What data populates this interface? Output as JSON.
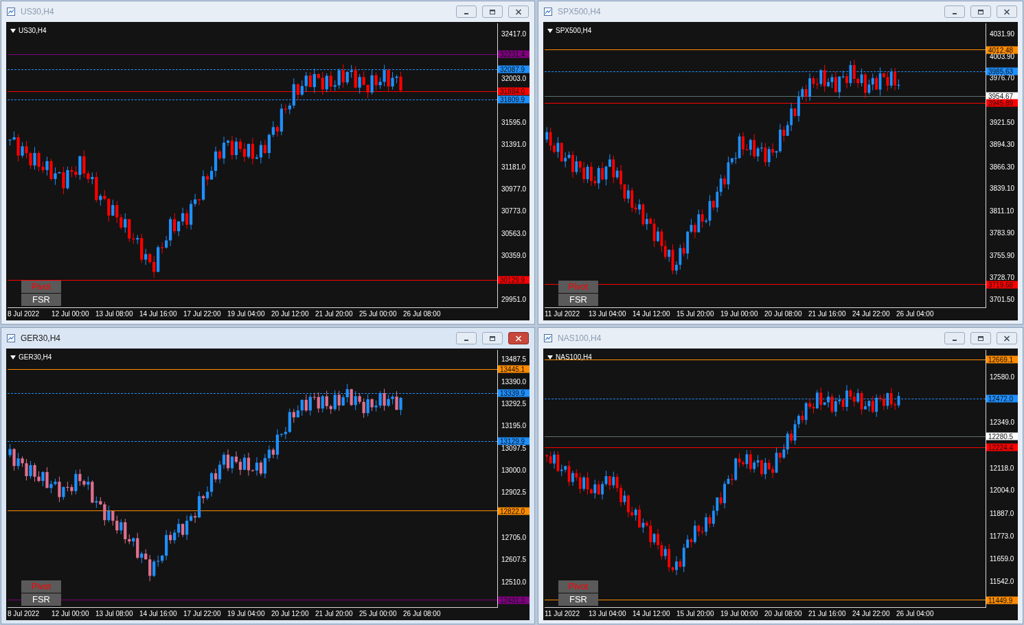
{
  "windows": [
    {
      "title": "US30,H4",
      "active": false,
      "chart_label": "US30,H4",
      "y_ticks": [
        "32417.0",
        "32003.0",
        "31595.0",
        "31391.0",
        "31181.0",
        "30977.0",
        "30773.0",
        "30563.0",
        "30359.0",
        "29951.0"
      ],
      "price_tags": [
        {
          "label": "32231.4",
          "color": "#800080",
          "dashed": false
        },
        {
          "label": "32087.9",
          "color": "#1e90ff",
          "dashed": true
        },
        {
          "label": "31884.0",
          "color": "#ff0000",
          "dashed": false
        },
        {
          "label": "31809.9",
          "color": "#1e90ff",
          "dashed": true
        },
        {
          "label": "30129.9",
          "color": "#ff0000",
          "dashed": false
        }
      ],
      "x_labels": [
        "8 Jul 2022",
        "12 Jul 00:00",
        "13 Jul 08:00",
        "14 Jul 16:00",
        "17 Jul 22:00",
        "19 Jul 04:00",
        "20 Jul 12:00",
        "21 Jul 20:00",
        "25 Jul 00:00",
        "26 Jul 08:00"
      ],
      "buttons": [
        "Pivot",
        "FSR"
      ]
    },
    {
      "title": "SPX500,H4",
      "active": false,
      "chart_label": "SPX500,H4",
      "y_ticks": [
        "4031.90",
        "4003.90",
        "3976.70",
        "3921.50",
        "3894.30",
        "3866.30",
        "3839.10",
        "3811.10",
        "3783.90",
        "3755.90",
        "3728.70",
        "3701.50"
      ],
      "price_tags": [
        {
          "label": "4012.48",
          "color": "#ff8c00",
          "dashed": false
        },
        {
          "label": "3985.63",
          "color": "#1e90ff",
          "dashed": true
        },
        {
          "label": "3954.67",
          "color": "#ffffff",
          "dashed": false
        },
        {
          "label": "3945.89",
          "color": "#ff0000",
          "dashed": false
        },
        {
          "label": "3719.68",
          "color": "#ff0000",
          "dashed": false
        }
      ],
      "x_labels": [
        "11 Jul 2022",
        "13 Jul 04:00",
        "14 Jul 12:00",
        "15 Jul 20:00",
        "19 Jul 00:00",
        "20 Jul 08:00",
        "21 Jul 16:00",
        "24 Jul 22:00",
        "26 Jul 04:00"
      ],
      "buttons": [
        "Pivot",
        "FSR"
      ]
    },
    {
      "title": "GER30,H4",
      "active": true,
      "chart_label": "GER30,H4",
      "y_ticks": [
        "13487.5",
        "13390.0",
        "13292.5",
        "13195.0",
        "13097.5",
        "13000.0",
        "12902.5",
        "12705.0",
        "12607.5",
        "12510.0"
      ],
      "price_tags": [
        {
          "label": "13445.1",
          "color": "#ff8c00",
          "dashed": false
        },
        {
          "label": "13339.9",
          "color": "#1e90ff",
          "dashed": true
        },
        {
          "label": "13129.9",
          "color": "#1e90ff",
          "dashed": true
        },
        {
          "label": "12822.0",
          "color": "#ff8c00",
          "dashed": false
        },
        {
          "label": "12431.3",
          "color": "#800080",
          "dashed": false
        }
      ],
      "x_labels": [
        "8 Jul 2022",
        "12 Jul 00:00",
        "13 Jul 08:00",
        "14 Jul 16:00",
        "17 Jul 22:00",
        "19 Jul 04:00",
        "20 Jul 12:00",
        "21 Jul 20:00",
        "25 Jul 00:00",
        "26 Jul 08:00"
      ],
      "buttons": [
        "Pivot",
        "FSR"
      ]
    },
    {
      "title": "NAS100,H4",
      "active": false,
      "chart_label": "NAS100,H4",
      "y_ticks": [
        "12580.0",
        "12349.0",
        "12118.0",
        "12004.0",
        "11887.0",
        "11773.0",
        "11659.0",
        "11542.0"
      ],
      "price_tags": [
        {
          "label": "12669.1",
          "color": "#ff8c00",
          "dashed": false
        },
        {
          "label": "12472.0",
          "color": "#1e90ff",
          "dashed": true
        },
        {
          "label": "12280.5",
          "color": "#ffffff",
          "dashed": false
        },
        {
          "label": "12224.4",
          "color": "#ff0000",
          "dashed": false
        },
        {
          "label": "11449.9",
          "color": "#ff8c00",
          "dashed": false
        }
      ],
      "x_labels": [
        "11 Jul 2022",
        "13 Jul 04:00",
        "14 Jul 12:00",
        "15 Jul 20:00",
        "19 Jul 00:00",
        "20 Jul 08:00",
        "21 Jul 16:00",
        "24 Jul 22:00",
        "26 Jul 04:00"
      ],
      "buttons": [
        "Pivot",
        "FSR"
      ]
    }
  ]
}
